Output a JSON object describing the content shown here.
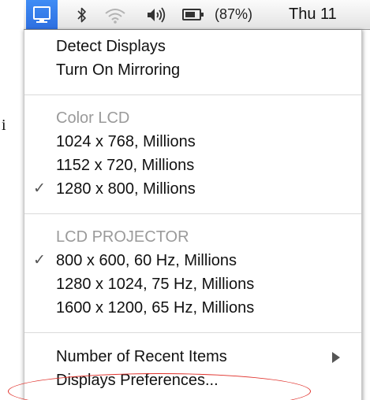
{
  "menubar": {
    "displays_icon": "monitor-icon",
    "bluetooth_icon": "bluetooth-icon",
    "wifi_icon": "wifi-icon",
    "volume_icon": "volume-icon",
    "battery_icon": "battery-icon",
    "battery_percent": "(87%)",
    "clock": "Thu 11",
    "displays_highlight_color": "#3a82f0"
  },
  "stray_text": "i",
  "menu": {
    "detect_displays": "Detect Displays",
    "turn_on_mirroring": "Turn On Mirroring",
    "sections": [
      {
        "header": "Color LCD",
        "items": [
          {
            "label": "1024 x 768, Millions",
            "checked": false
          },
          {
            "label": "1152 x 720, Millions",
            "checked": false
          },
          {
            "label": "1280 x 800, Millions",
            "checked": true
          }
        ]
      },
      {
        "header": "LCD PROJECTOR",
        "items": [
          {
            "label": "800 x 600, 60 Hz, Millions",
            "checked": true
          },
          {
            "label": "1280 x 1024, 75 Hz, Millions",
            "checked": false
          },
          {
            "label": "1600 x 1200, 65 Hz, Millions",
            "checked": false
          }
        ]
      }
    ],
    "check_glyph": "✓",
    "recent_items": "Number of Recent Items",
    "submenu_arrow_icon": "triangle-right-icon",
    "displays_preferences": "Displays Preferences..."
  },
  "annotation_color": "#e0302a"
}
